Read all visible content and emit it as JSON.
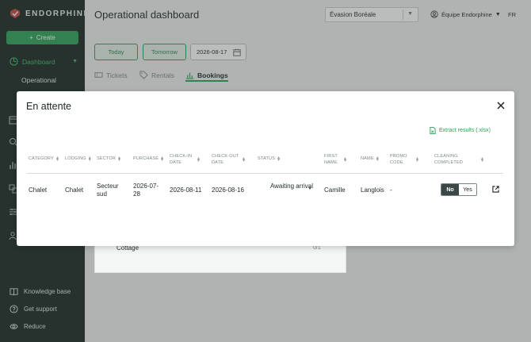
{
  "brand": {
    "name": "ENDORPHINE"
  },
  "sidebar": {
    "create_label": "Create",
    "dashboard_label": "Dashboard",
    "sub_item": "Operational",
    "bottom": [
      {
        "label": "Knowledge base",
        "icon": "book-icon"
      },
      {
        "label": "Get support",
        "icon": "help-icon"
      },
      {
        "label": "Reduce",
        "icon": "eye-icon"
      }
    ]
  },
  "header": {
    "title": "Operational dashboard",
    "org_select": "Évasion Boréale",
    "team": "Équipe Endorphine",
    "lang": "FR"
  },
  "filters": {
    "today": "Today",
    "tomorrow": "Tomorrow",
    "date": "2026-08-17"
  },
  "tabs": [
    {
      "label": "Tickets",
      "icon": "ticket-icon"
    },
    {
      "label": "Rentals",
      "icon": "tag-icon"
    },
    {
      "label": "Bookings",
      "icon": "chart-icon"
    }
  ],
  "background": {
    "row_label": "Cottage",
    "row_count": "0/1"
  },
  "modal": {
    "title": "En attente",
    "extract_label": "Extract results (.xlsx)",
    "columns": [
      "Category",
      "Lodging",
      "Sector",
      "Purchase",
      "Check-in date",
      "Check-out date",
      "Status",
      "First name",
      "Name",
      "Promo code",
      "Cleaning completed"
    ],
    "row": {
      "category": "Chalet",
      "lodging": "Chalet",
      "sector": "Secteur sud",
      "purchase": "2026-07-28",
      "check_in": "2026-08-11",
      "check_out": "2026-08-16",
      "status": "Awaiting arrival",
      "first_name": "Camille",
      "name": "Langlois",
      "promo": "-",
      "cleaning_no": "No",
      "cleaning_yes": "Yes"
    }
  },
  "colors": {
    "accent": "#2fa45a",
    "sidebar": "#1d2a27"
  }
}
